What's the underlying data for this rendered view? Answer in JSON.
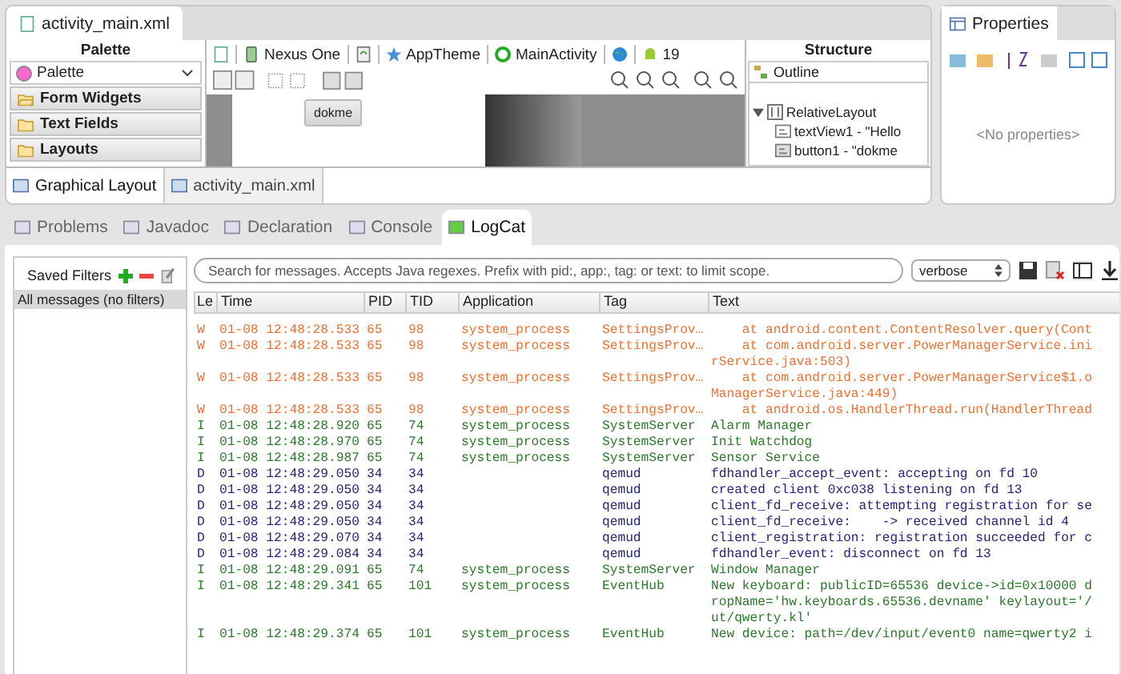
{
  "editor": {
    "tab": "activity_main.xml",
    "palette": {
      "title": "Palette",
      "dropdown": "Palette",
      "categories": [
        {
          "label": "Form Widgets",
          "expanded": true
        },
        {
          "label": "Text Fields",
          "expanded": false
        },
        {
          "label": "Layouts",
          "expanded": false
        }
      ]
    },
    "toolbar": {
      "device": "Nexus One",
      "theme": "AppTheme",
      "activity": "MainActivity",
      "api": "19"
    },
    "canvas": {
      "button": "dokme"
    },
    "structure": {
      "title": "Structure",
      "outline": "Outline",
      "tree": [
        {
          "kind": "layout",
          "label": "RelativeLayout",
          "expanded": true,
          "children": [
            {
              "kind": "text",
              "label": "textView1 - \"Hello"
            },
            {
              "kind": "button",
              "label": "button1 - \"dokme"
            }
          ]
        }
      ]
    },
    "bottom_tabs": [
      {
        "label": "Graphical Layout",
        "selected": true
      },
      {
        "label": "activity_main.xml",
        "selected": false
      }
    ]
  },
  "properties": {
    "title": "Properties",
    "empty": "<No properties>"
  },
  "console": {
    "tabs": [
      {
        "label": "Problems",
        "selected": false
      },
      {
        "label": "Javadoc",
        "selected": false
      },
      {
        "label": "Declaration",
        "selected": false
      },
      {
        "label": "Console",
        "selected": false
      },
      {
        "label": "LogCat",
        "selected": true
      }
    ],
    "saved_filters": {
      "title": "Saved Filters",
      "items": [
        {
          "label": "All messages (no filters)",
          "selected": true
        }
      ]
    },
    "search": {
      "placeholder": "Search for messages. Accepts Java regexes. Prefix with pid:, app:, tag: or text: to limit scope."
    },
    "level_select": "verbose",
    "columns": [
      "Le",
      "Time",
      "PID",
      "TID",
      "Application",
      "Tag",
      "Text"
    ],
    "rows": [
      {
        "kind": "warn",
        "priority": "W",
        "time": "01-08 12:48:28.533",
        "pid": "65",
        "tid": "98",
        "application": "system_process",
        "tag": "SettingsProv…",
        "text": [
          "    at android.content.ContentResolver.query(Cont"
        ]
      },
      {
        "kind": "warn",
        "priority": "W",
        "time": "01-08 12:48:28.533",
        "pid": "65",
        "tid": "98",
        "application": "system_process",
        "tag": "SettingsProv…",
        "text": [
          "    at com.android.server.PowerManagerService.ini",
          "rService.java:503)"
        ]
      },
      {
        "kind": "warn",
        "priority": "W",
        "time": "01-08 12:48:28.533",
        "pid": "65",
        "tid": "98",
        "application": "system_process",
        "tag": "SettingsProv…",
        "text": [
          "    at com.android.server.PowerManagerService$1.o",
          "ManagerService.java:449)"
        ]
      },
      {
        "kind": "warn",
        "priority": "W",
        "time": "01-08 12:48:28.533",
        "pid": "65",
        "tid": "98",
        "application": "system_process",
        "tag": "SettingsProv…",
        "text": [
          "    at android.os.HandlerThread.run(HandlerThread"
        ]
      },
      {
        "kind": "info",
        "priority": "I",
        "time": "01-08 12:48:28.920",
        "pid": "65",
        "tid": "74",
        "application": "system_process",
        "tag": "SystemServer",
        "text": [
          "Alarm Manager"
        ]
      },
      {
        "kind": "info",
        "priority": "I",
        "time": "01-08 12:48:28.970",
        "pid": "65",
        "tid": "74",
        "application": "system_process",
        "tag": "SystemServer",
        "text": [
          "Init Watchdog"
        ]
      },
      {
        "kind": "info",
        "priority": "I",
        "time": "01-08 12:48:28.987",
        "pid": "65",
        "tid": "74",
        "application": "system_process",
        "tag": "SystemServer",
        "text": [
          "Sensor Service"
        ]
      },
      {
        "kind": "debug",
        "priority": "D",
        "time": "01-08 12:48:29.050",
        "pid": "34",
        "tid": "34",
        "tag": "qemud",
        "text": [
          "fdhandler_accept_event: accepting on fd 10"
        ]
      },
      {
        "kind": "debug",
        "priority": "D",
        "time": "01-08 12:48:29.050",
        "pid": "34",
        "tid": "34",
        "tag": "qemud",
        "text": [
          "created client 0xc038 listening on fd 13"
        ]
      },
      {
        "kind": "debug",
        "priority": "D",
        "time": "01-08 12:48:29.050",
        "pid": "34",
        "tid": "34",
        "tag": "qemud",
        "text": [
          "client_fd_receive: attempting registration for se"
        ]
      },
      {
        "kind": "debug",
        "priority": "D",
        "time": "01-08 12:48:29.050",
        "pid": "34",
        "tid": "34",
        "tag": "qemud",
        "text": [
          "client_fd_receive:    -> received channel id 4"
        ]
      },
      {
        "kind": "debug",
        "priority": "D",
        "time": "01-08 12:48:29.070",
        "pid": "34",
        "tid": "34",
        "tag": "qemud",
        "text": [
          "client_registration: registration succeeded for c"
        ]
      },
      {
        "kind": "debug",
        "priority": "D",
        "time": "01-08 12:48:29.084",
        "pid": "34",
        "tid": "34",
        "tag": "qemud",
        "text": [
          "fdhandler_event: disconnect on fd 13"
        ]
      },
      {
        "kind": "info",
        "priority": "I",
        "time": "01-08 12:48:29.091",
        "pid": "65",
        "tid": "74",
        "application": "system_process",
        "tag": "SystemServer",
        "text": [
          "Window Manager"
        ]
      },
      {
        "kind": "info",
        "priority": "I",
        "time": "01-08 12:48:29.341",
        "pid": "65",
        "tid": "101",
        "application": "system_process",
        "tag": "EventHub",
        "text": [
          "New keyboard: publicID=65536 device->id=0x10000 d",
          "ropName='hw.keyboards.65536.devname' keylayout='/",
          "ut/qwerty.kl'"
        ]
      },
      {
        "kind": "info",
        "priority": "I",
        "time": "01-08 12:48:29.374",
        "pid": "65",
        "tid": "101",
        "application": "system_process",
        "tag": "EventHub",
        "text": [
          "New device: path=/dev/input/event0 name=qwerty2 i"
        ]
      }
    ]
  }
}
